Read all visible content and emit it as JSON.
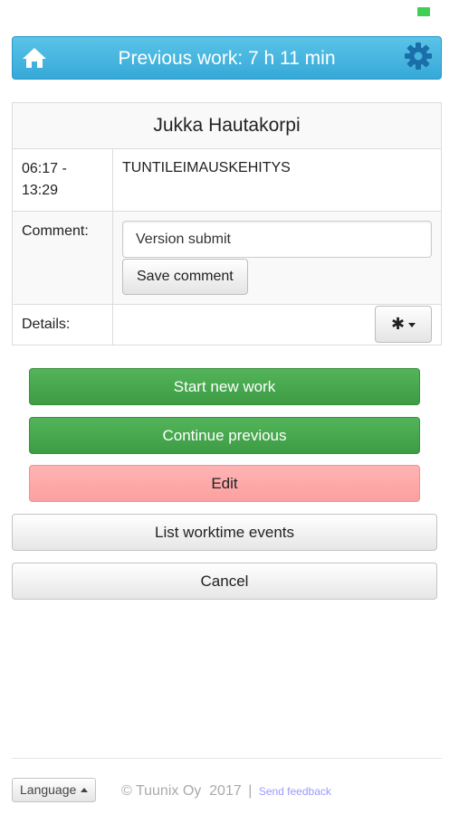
{
  "header": {
    "title": "Previous work: 7 h 11 min",
    "home_icon": "home-icon",
    "settings_icon": "gear-icon",
    "color": "#45b5e0"
  },
  "work": {
    "person": "Jukka Hautakorpi",
    "time_start": "06:17 -",
    "time_end": "13:29",
    "project": "TUNTILEIMAUSKEHITYS",
    "comment_label": "Comment:",
    "comment_value": "Version submit",
    "save_comment_label": "Save comment",
    "details_label": "Details:",
    "details_icon": "asterisk-icon"
  },
  "actions": {
    "start_new": "Start new work",
    "continue_previous": "Continue previous",
    "edit": "Edit",
    "list_events": "List worktime events",
    "cancel": "Cancel"
  },
  "footer": {
    "language_label": "Language",
    "copyright": "© Tuunix Oy  2017",
    "separator": "|",
    "feedback": "Send feedback"
  },
  "status": {
    "battery_color": "#3fcf55"
  }
}
